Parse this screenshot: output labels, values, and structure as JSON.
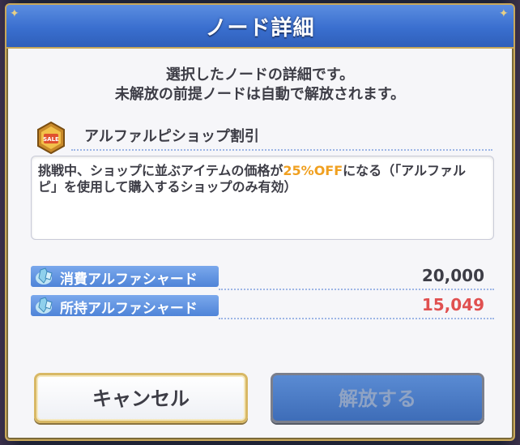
{
  "dialog": {
    "title": "ノード詳細",
    "description_line1": "選択したノードの詳細です。",
    "description_line2": "未解放の前提ノードは自動で解放されます。"
  },
  "node": {
    "name": "アルファルピショップ割引",
    "icon": "shop-sale-icon",
    "effect_before": "挑戦中、ショップに並ぶアイテムの価格が",
    "effect_highlight": "25%OFF",
    "effect_after": "になる（「アルファルピ」を使用して購入するショップのみ有効）"
  },
  "resources": {
    "consume_label": "消費アルファシャード",
    "consume_value": "20,000",
    "owned_label": "所持アルファシャード",
    "owned_value": "15,049"
  },
  "buttons": {
    "cancel_label": "キャンセル",
    "release_label": "解放する"
  },
  "colors": {
    "header_blue": "#3a6fcf",
    "highlight_orange": "#f0a020",
    "insufficient_red": "#e05050",
    "frame_gold": "#c9a85a"
  }
}
